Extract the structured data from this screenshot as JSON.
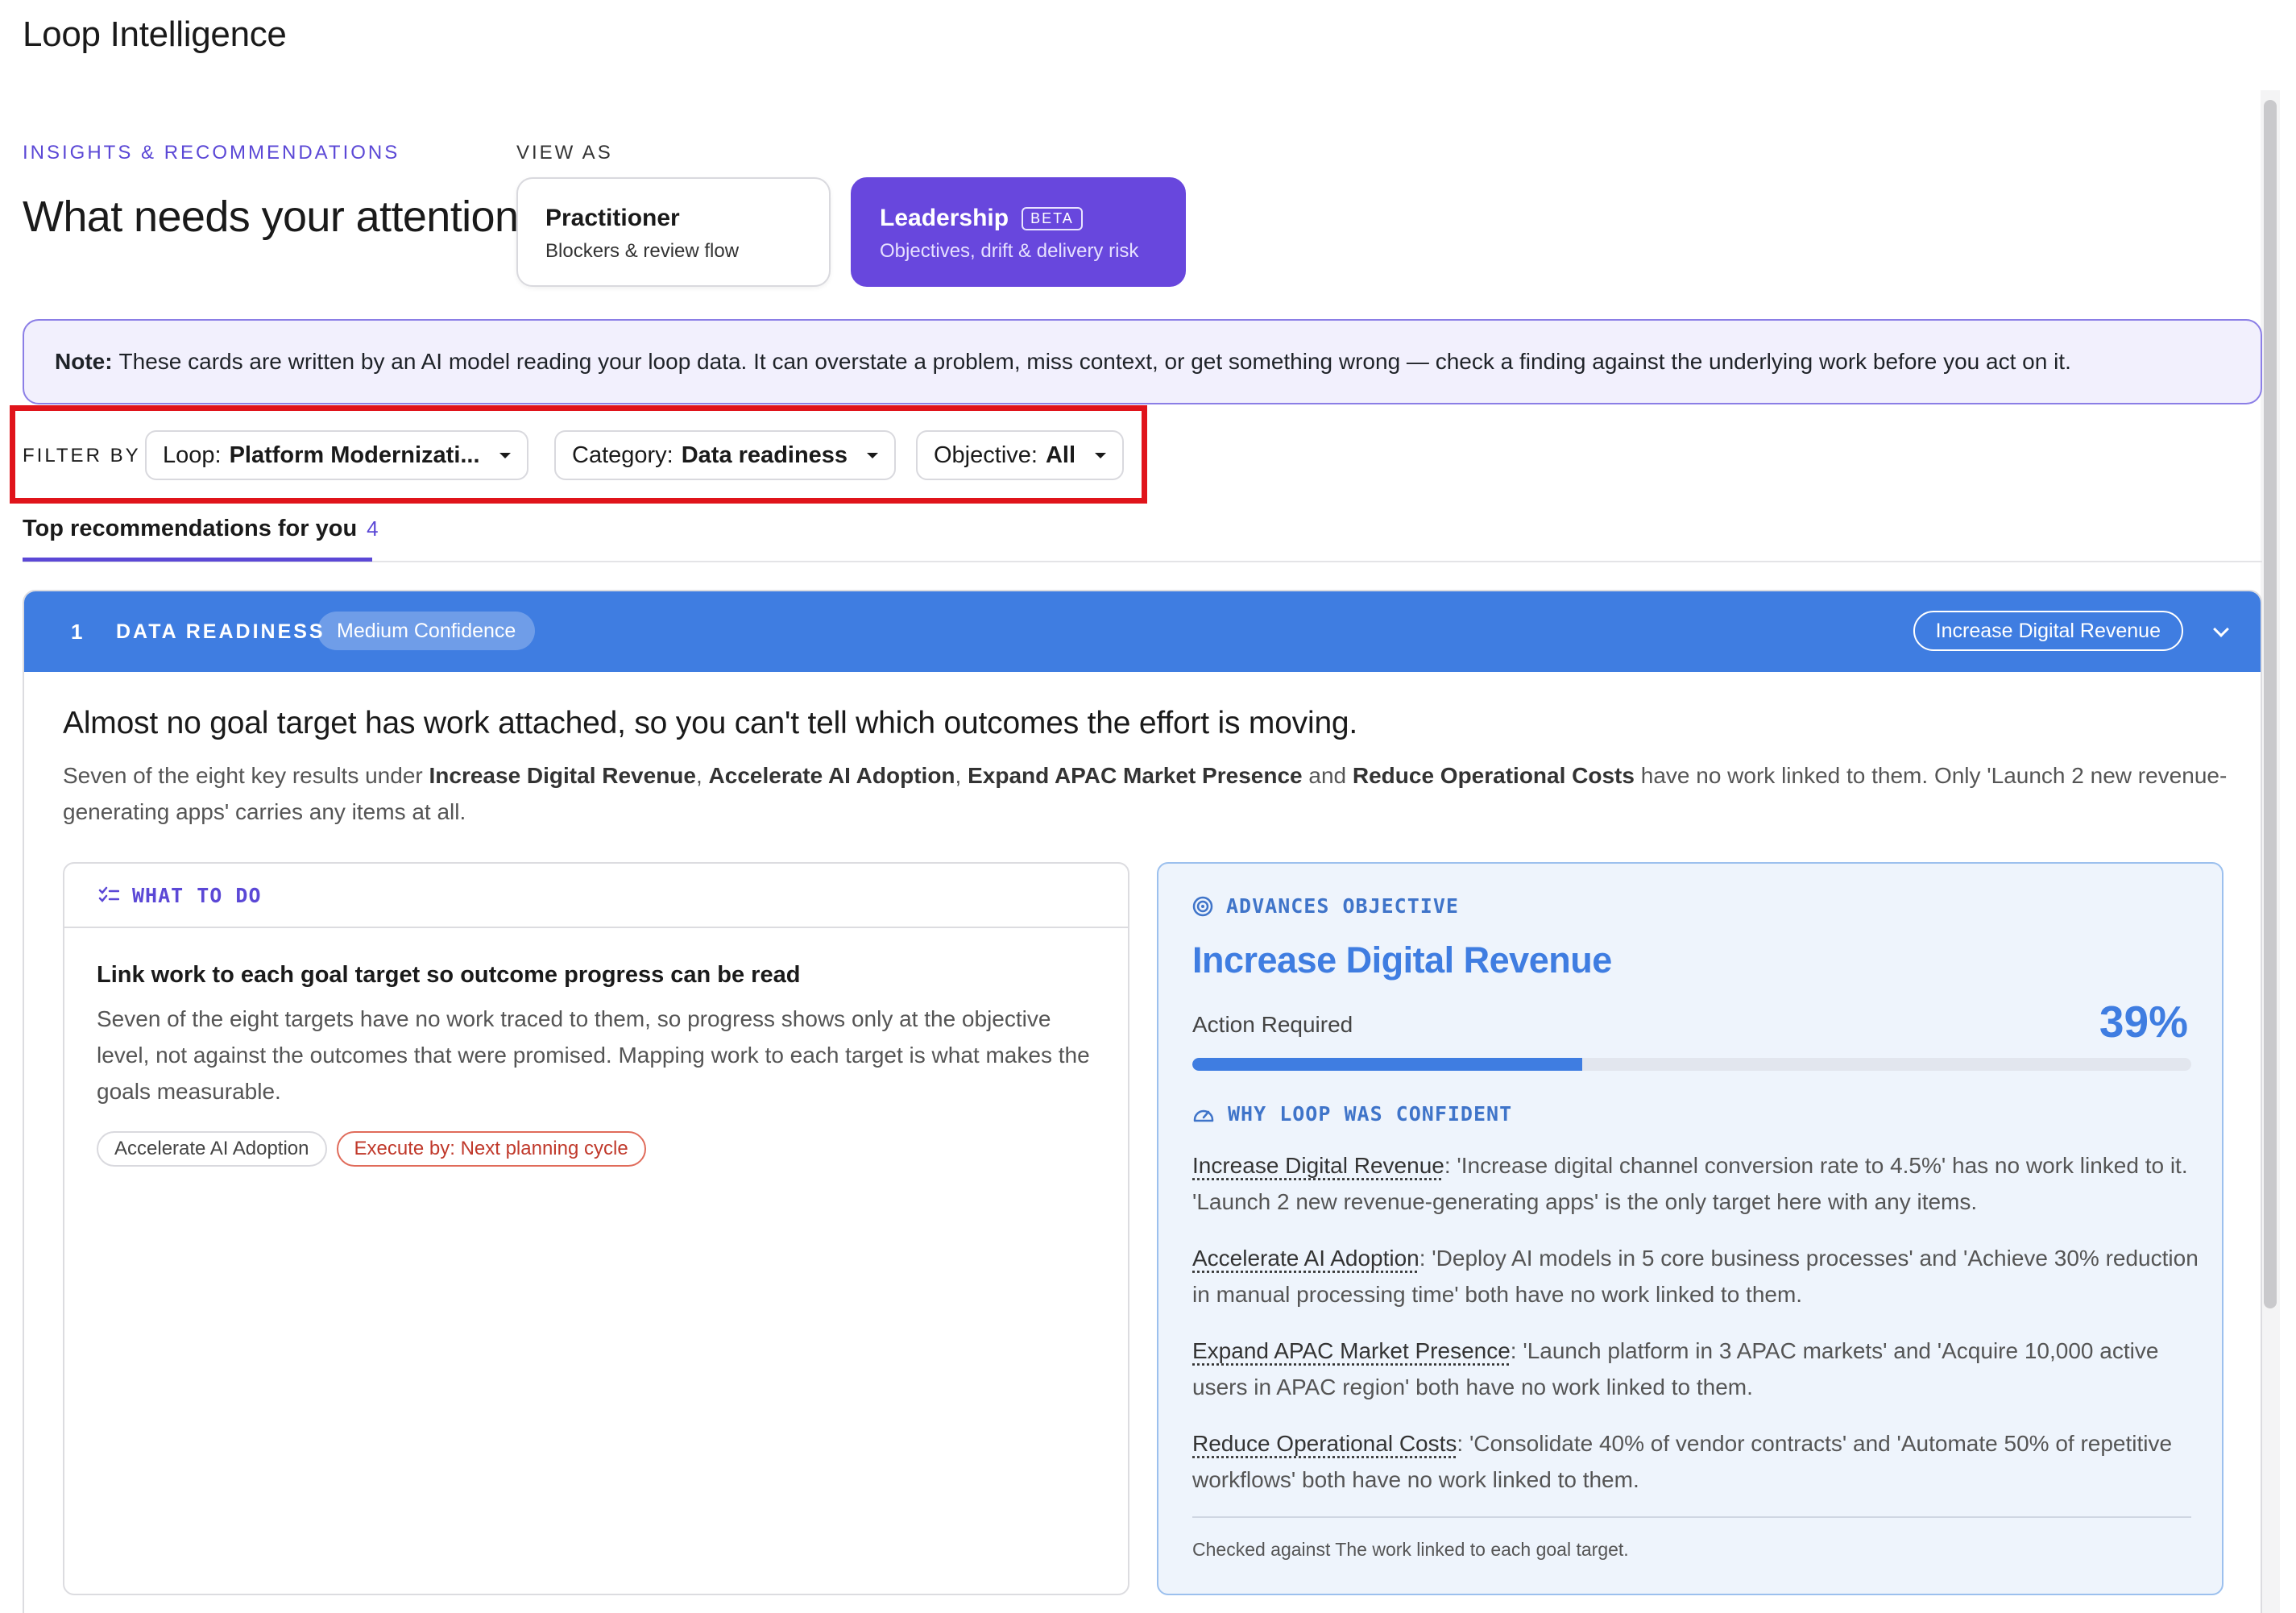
{
  "app": {
    "title": "Loop Intelligence"
  },
  "header": {
    "eyebrow": "INSIGHTS & RECOMMENDATIONS",
    "headline": "What needs your attention",
    "view_as_label": "VIEW AS",
    "roles": [
      {
        "name": "Practitioner",
        "subtitle": "Blockers & review flow",
        "selected": false
      },
      {
        "name": "Leadership",
        "badge": "BETA",
        "subtitle": "Objectives, drift & delivery risk",
        "selected": true
      }
    ]
  },
  "note": {
    "label": "Note:",
    "text": "These cards are written by an AI model reading your loop data. It can overstate a problem, miss context, or get something wrong — check a finding against the underlying work before you act on it."
  },
  "filters": {
    "label": "FILTER BY",
    "loop": {
      "key": "Loop:",
      "value": "Platform Modernizati..."
    },
    "category": {
      "key": "Category:",
      "value": "Data readiness"
    },
    "objective": {
      "key": "Objective:",
      "value": "All"
    }
  },
  "tabs": [
    {
      "label": "Top recommendations for you",
      "count": "4",
      "active": true
    }
  ],
  "recommendation": {
    "rank": "1",
    "category": "DATA READINESS",
    "confidence": "Medium Confidence",
    "objective_chip": "Increase Digital Revenue",
    "finding": "Almost no goal target has work attached, so you can't tell which outcomes the effort is moving.",
    "detail": {
      "p1": "Seven of the eight key results under ",
      "o1": "Increase Digital Revenue",
      "s1": ", ",
      "o2": "Accelerate AI Adoption",
      "s2": ", ",
      "o3": "Expand APAC Market Presence",
      "s3": " and ",
      "o4": "Reduce Operational Costs",
      "p2": " have no work linked to them. Only 'Launch 2 new revenue-generating apps' carries any items at all."
    },
    "what_to_do": {
      "section_title": "WHAT TO DO",
      "icon": "checklist-icon",
      "title": "Link work to each goal target so outcome progress can be read",
      "body": "Seven of the eight targets have no work traced to them, so progress shows only at the objective level, not against the outcomes that were promised. Mapping work to each target is what makes the goals measurable.",
      "tags": [
        {
          "label": "Accelerate AI Adoption",
          "kind": "neutral"
        },
        {
          "label": "Execute by: Next planning cycle",
          "kind": "warn"
        }
      ]
    },
    "advances": {
      "section_title": "ADVANCES OBJECTIVE",
      "icon": "target-icon",
      "objective": "Increase Digital Revenue",
      "status": "Action Required",
      "progress_label": "39%",
      "progress": 0.39,
      "why_title": "WHY LOOP WAS CONFIDENT",
      "why_icon": "gauge-icon",
      "reasons": [
        {
          "objective": "Increase Digital Revenue",
          "text": ": 'Increase digital channel conversion rate to 4.5%' has no work linked to it. 'Launch 2 new revenue-generating apps' is the only target here with any items."
        },
        {
          "objective": "Accelerate AI Adoption",
          "text": ": 'Deploy AI models in 5 core business processes' and 'Achieve 30% reduction in manual processing time' both have no work linked to them."
        },
        {
          "objective": "Expand APAC Market Presence",
          "text": ": 'Launch platform in 3 APAC markets' and 'Acquire 10,000 active users in APAC region' both have no work linked to them."
        },
        {
          "objective": "Reduce Operational Costs",
          "text": ": 'Consolidate 40% of vendor contracts' and 'Automate 50% of repetitive workflows' both have no work linked to them."
        }
      ],
      "checked_against": "Checked against The work linked to each goal target."
    }
  },
  "colors": {
    "accent": "#5b48d6",
    "leadership": "#6847dd",
    "card_header": "#3f7de1",
    "highlight": "#e0141b",
    "warn": "#c0392b"
  }
}
